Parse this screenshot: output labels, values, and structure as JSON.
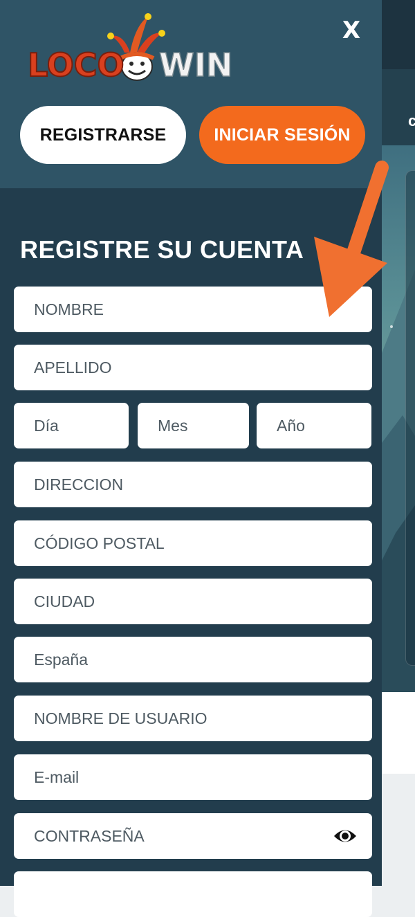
{
  "header": {
    "logo_left": "LOCO",
    "logo_right": "WIN",
    "close_label": "X",
    "register_label": "REGISTRARSE",
    "login_label": "INICIAR SESIÓN"
  },
  "form": {
    "title": "REGISTRE SU CUENTA",
    "nombre": "NOMBRE",
    "apellido": "APELLIDO",
    "dia": "Día",
    "mes": "Mes",
    "ano": "Año",
    "direccion": "DIRECCION",
    "codigo_postal": "CÓDIGO POSTAL",
    "ciudad": "CIUDAD",
    "pais": "España",
    "usuario": "NOMBRE DE USUARIO",
    "email": "E-mail",
    "contrasena": "CONTRASEÑA"
  },
  "background_page": {
    "subbar_text": "c"
  },
  "colors": {
    "drawer_bg": "#223d4d",
    "header_bg": "#2f5466",
    "accent_orange": "#f36a1d",
    "arrow_orange": "#f07030"
  },
  "icons": {
    "close": "close-icon",
    "eye": "eye-icon",
    "hamburger": "hamburger-icon",
    "logo_mascot": "jester-mascot-icon"
  }
}
